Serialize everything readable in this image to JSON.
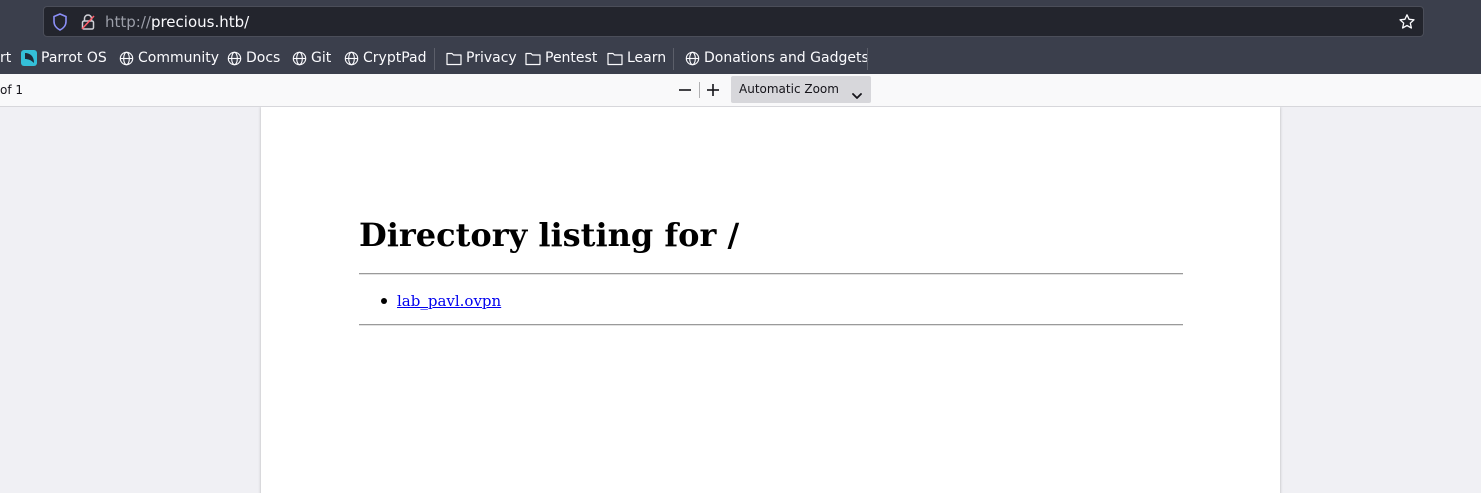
{
  "browser": {
    "url_scheme": "http://",
    "url_host": "precious.htb/"
  },
  "bookmarks": [
    {
      "label": "rt",
      "icon": "none"
    },
    {
      "label": "Parrot OS",
      "icon": "parrot-icon"
    },
    {
      "label": "Community",
      "icon": "globe-icon"
    },
    {
      "label": "Docs",
      "icon": "globe-icon"
    },
    {
      "label": "Git",
      "icon": "globe-icon"
    },
    {
      "label": "CryptPad",
      "icon": "globe-icon"
    },
    {
      "label": "Privacy",
      "icon": "folder-icon"
    },
    {
      "label": "Pentest",
      "icon": "folder-icon"
    },
    {
      "label": "Learn",
      "icon": "folder-icon"
    },
    {
      "label": "Donations and Gadgets",
      "icon": "globe-icon"
    }
  ],
  "pdf_toolbar": {
    "page_count": "of 1",
    "zoom_level": "Automatic Zoom"
  },
  "document": {
    "heading": "Directory listing for /",
    "files": [
      "lab_pavl.ovpn"
    ]
  },
  "colors": {
    "chrome_bg": "#3b3f4c",
    "urlbar_bg": "#23252d",
    "link": "#0000ee"
  }
}
